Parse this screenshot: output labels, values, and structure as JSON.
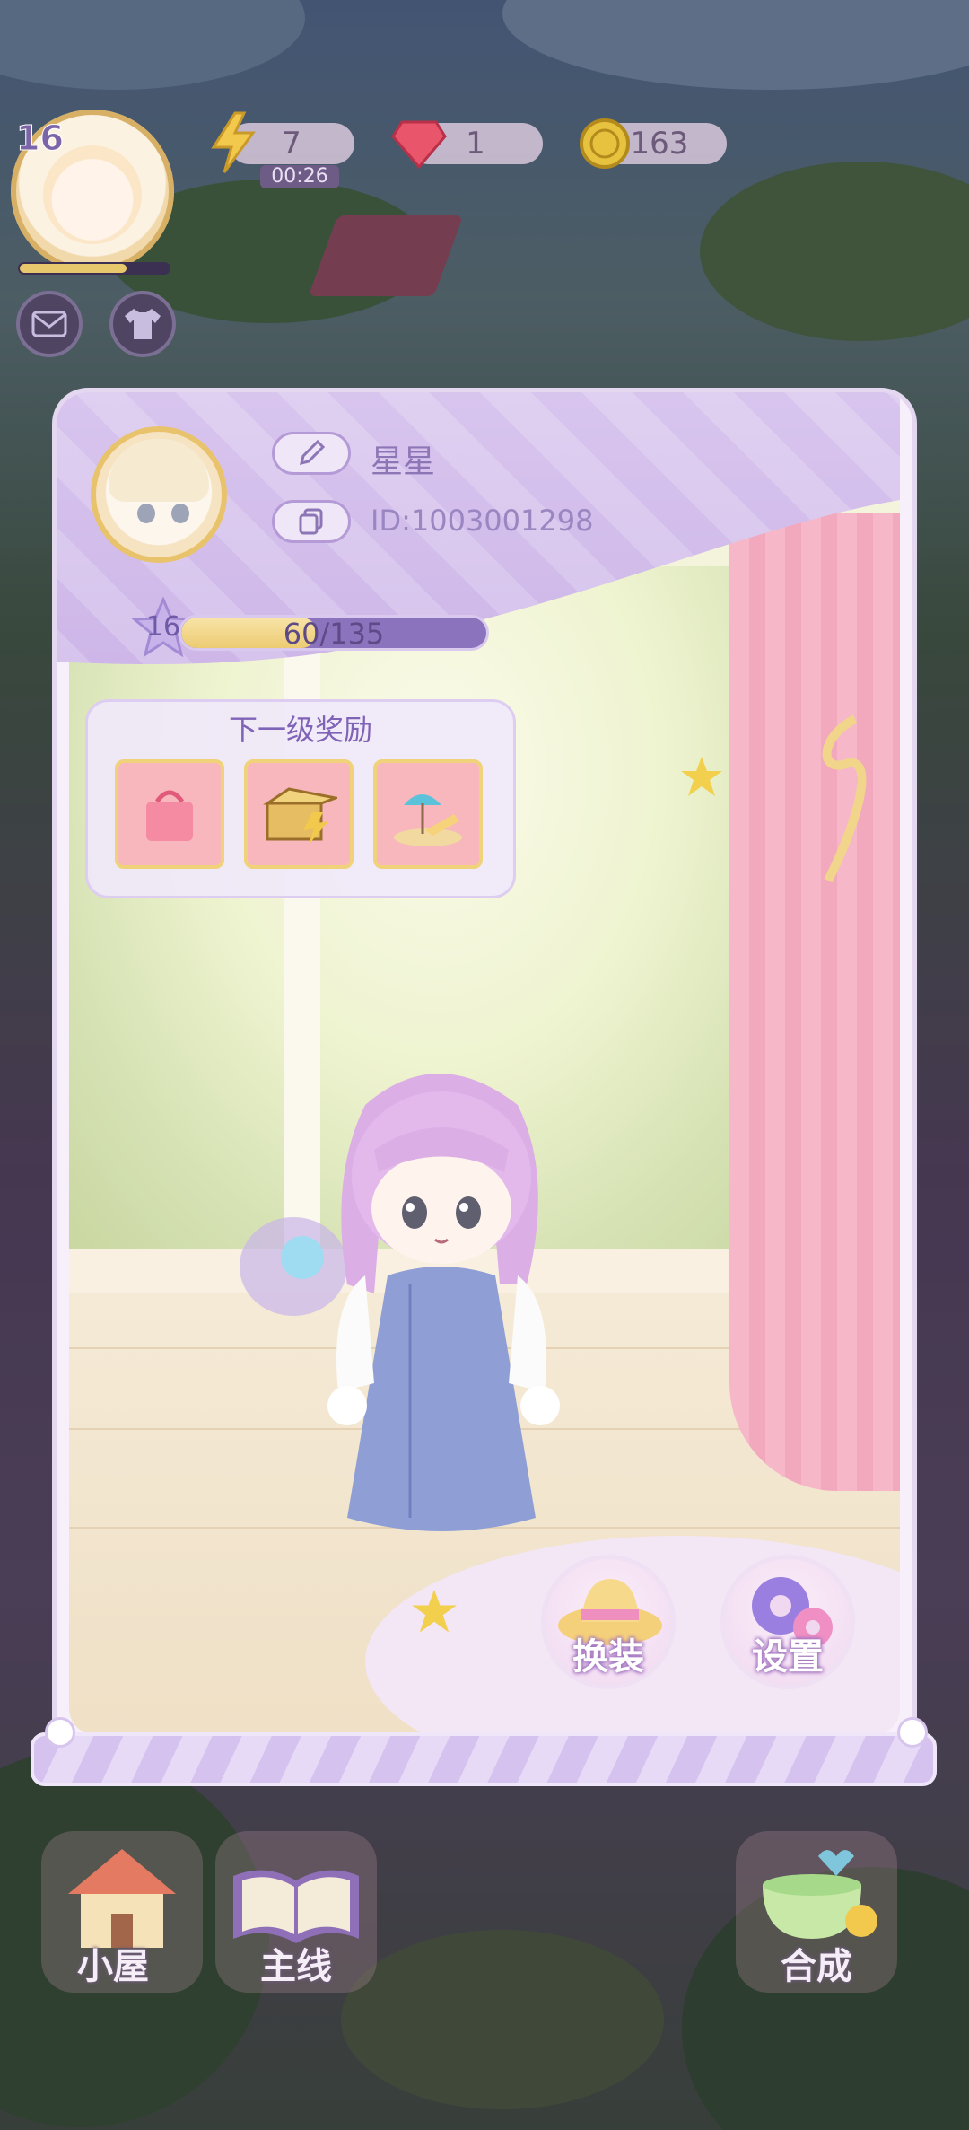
{
  "hud": {
    "level": "16",
    "energy": "7",
    "energy_timer": "00:26",
    "gems": "1",
    "coins": "163"
  },
  "profile": {
    "name": "星星",
    "id": "ID:1003001298",
    "level": "16",
    "xp_text": "60/135",
    "xp_fraction": 0.444,
    "next_reward_title": "下一级奖励",
    "rewards": [
      "pink-bag-icon",
      "treasure-box-icon",
      "beach-chair-icon"
    ]
  },
  "actions": {
    "dress_up": "换装",
    "settings": "设置"
  },
  "bottom_nav": {
    "house": "小屋",
    "main_story": "主线",
    "merge": "合成"
  },
  "colors": {
    "panel_accent": "#cdb6e8",
    "xp_fill": "#eccb72",
    "curtain": "#f6b8c8"
  }
}
